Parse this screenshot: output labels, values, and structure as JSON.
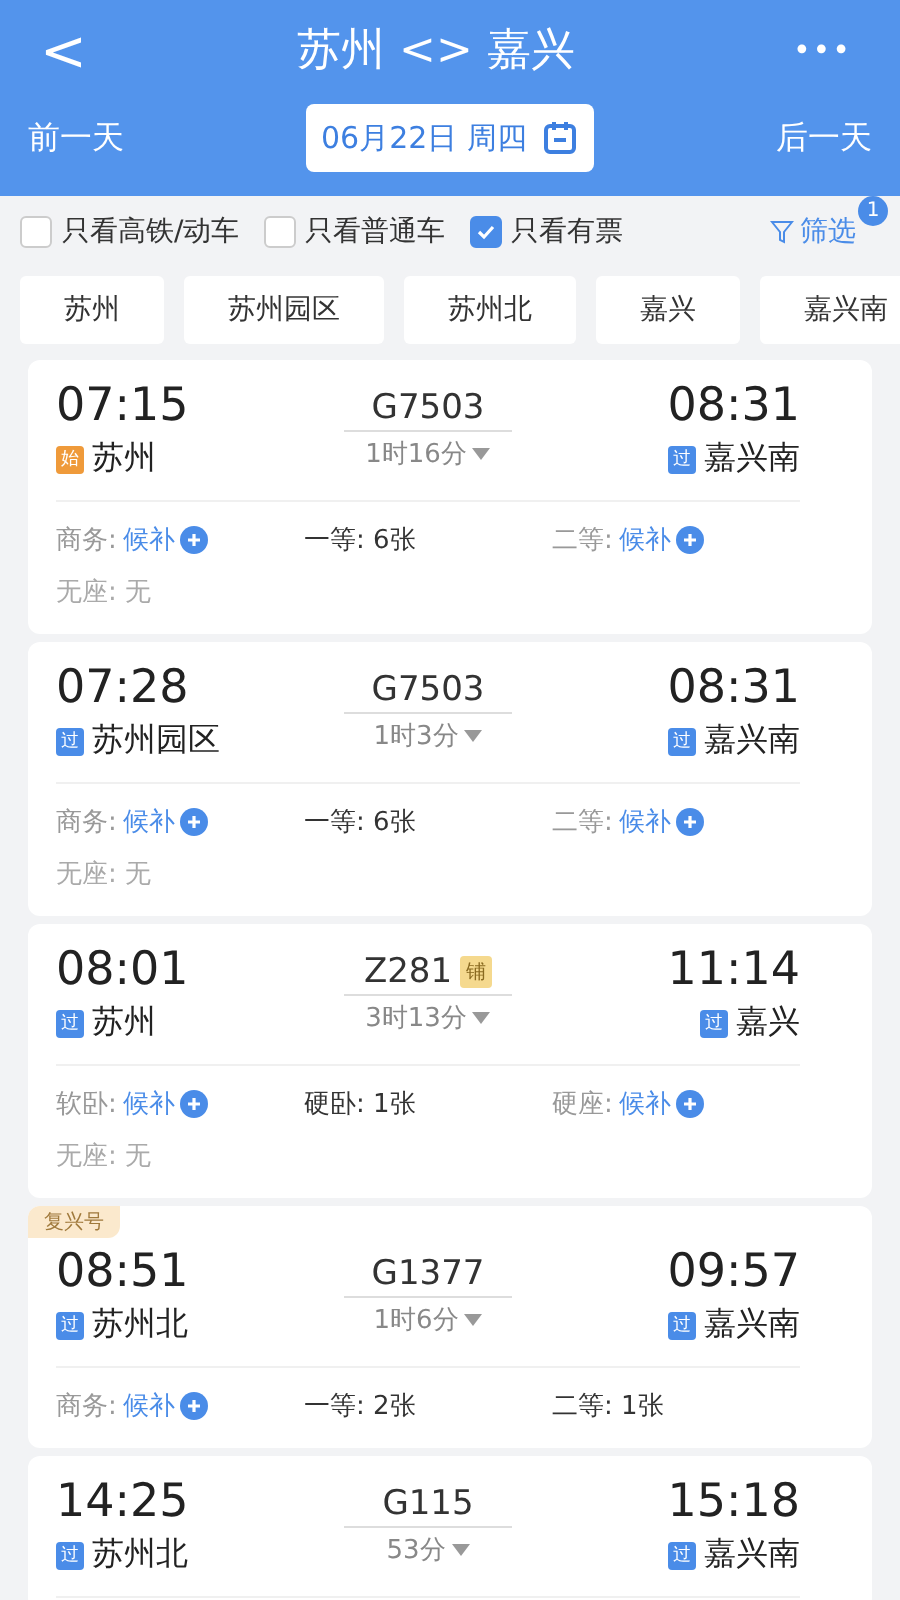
{
  "header": {
    "back": "<",
    "title": "苏州 <> 嘉兴",
    "more": "•••",
    "prev_day": "前一天",
    "date": "06月22日 周四",
    "next_day": "后一天"
  },
  "filters": [
    {
      "label": "只看高铁/动车",
      "checked": false
    },
    {
      "label": "只看普通车",
      "checked": false
    },
    {
      "label": "只看有票",
      "checked": true
    }
  ],
  "filter_button": {
    "label": "筛选",
    "badge": "1"
  },
  "stations": [
    {
      "label": "苏州"
    },
    {
      "label": "苏州园区"
    },
    {
      "label": "苏州北"
    },
    {
      "label": "嘉兴"
    },
    {
      "label": "嘉兴南"
    }
  ],
  "trains": [
    {
      "depart": "07:15",
      "from_tag": {
        "text": "始",
        "kind": "origin"
      },
      "from": "苏州",
      "number": "G7503",
      "duration": "1时16分",
      "arrive": "08:31",
      "to_tag": {
        "text": "过",
        "kind": "pass"
      },
      "to": "嘉兴南",
      "seats": [
        {
          "label": "商务:",
          "value": "候补",
          "kind": "waitlist"
        },
        {
          "label": "一等:",
          "value": "6张",
          "kind": "available"
        },
        {
          "label": "二等:",
          "value": "候补",
          "kind": "waitlist"
        },
        {
          "label": "无座:",
          "value": "无",
          "kind": "none"
        }
      ]
    },
    {
      "depart": "07:28",
      "from_tag": {
        "text": "过",
        "kind": "pass"
      },
      "from": "苏州园区",
      "number": "G7503",
      "duration": "1时3分",
      "arrive": "08:31",
      "to_tag": {
        "text": "过",
        "kind": "pass"
      },
      "to": "嘉兴南",
      "seats": [
        {
          "label": "商务:",
          "value": "候补",
          "kind": "waitlist"
        },
        {
          "label": "一等:",
          "value": "6张",
          "kind": "available"
        },
        {
          "label": "二等:",
          "value": "候补",
          "kind": "waitlist"
        },
        {
          "label": "无座:",
          "value": "无",
          "kind": "none"
        }
      ]
    },
    {
      "depart": "08:01",
      "from_tag": {
        "text": "过",
        "kind": "pass"
      },
      "from": "苏州",
      "number": "Z281",
      "number_badge": "铺",
      "duration": "3时13分",
      "arrive": "11:14",
      "to_tag": {
        "text": "过",
        "kind": "pass"
      },
      "to": "嘉兴",
      "seats": [
        {
          "label": "软卧:",
          "value": "候补",
          "kind": "waitlist"
        },
        {
          "label": "硬卧:",
          "value": "1张",
          "kind": "available"
        },
        {
          "label": "硬座:",
          "value": "候补",
          "kind": "waitlist"
        },
        {
          "label": "无座:",
          "value": "无",
          "kind": "none"
        }
      ]
    },
    {
      "ribbon": "复兴号",
      "depart": "08:51",
      "from_tag": {
        "text": "过",
        "kind": "pass"
      },
      "from": "苏州北",
      "number": "G1377",
      "duration": "1时6分",
      "arrive": "09:57",
      "to_tag": {
        "text": "过",
        "kind": "pass"
      },
      "to": "嘉兴南",
      "seats": [
        {
          "label": "商务:",
          "value": "候补",
          "kind": "waitlist"
        },
        {
          "label": "一等:",
          "value": "2张",
          "kind": "available"
        },
        {
          "label": "二等:",
          "value": "1张",
          "kind": "available"
        }
      ]
    },
    {
      "depart": "14:25",
      "from_tag": {
        "text": "过",
        "kind": "pass"
      },
      "from": "苏州北",
      "number": "G115",
      "duration": "53分",
      "arrive": "15:18",
      "to_tag": {
        "text": "过",
        "kind": "pass"
      },
      "to": "嘉兴南"
    }
  ]
}
